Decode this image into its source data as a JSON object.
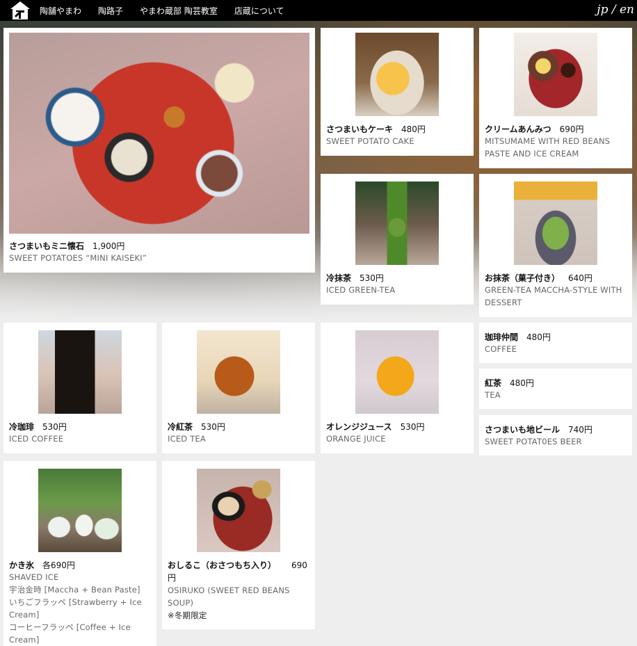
{
  "header": {
    "nav": [
      "陶舗やまわ",
      "陶路子",
      "やまわ蔵部 陶芸教室",
      "店蔵について"
    ],
    "lang": "jp / en"
  },
  "items": [
    {
      "name": "さつまいもミニ懐石",
      "price": "1,900円",
      "en": "SWEET POTATOES “MINI KAISEKI”"
    },
    {
      "name": "さつまいもケーキ",
      "price": "480円",
      "en": "SWEET POTATO CAKE"
    },
    {
      "name": "クリームあんみつ",
      "price": "690円",
      "en": "MITSUMAME WITH RED BEANS PASTE AND ICE CREAM"
    },
    {
      "name": "冷抹茶",
      "price": "530円",
      "en": "ICED GREEN-TEA"
    },
    {
      "name": "お抹茶（菓子付き）",
      "price": "640円",
      "en": "GREEN-TEA MACCHA-STYLE WITH DESSERT"
    },
    {
      "name": "冷珈琲",
      "price": "530円",
      "en": "ICED COFFEE"
    },
    {
      "name": "冷紅茶",
      "price": "530円",
      "en": "ICED TEA"
    },
    {
      "name": "オレンジジュース",
      "price": "530円",
      "en": "ORANGE JUICE"
    },
    {
      "name": "珈琲仲間",
      "price": "480円",
      "en": "COFFEE"
    },
    {
      "name": "紅茶",
      "price": "480円",
      "en": "TEA"
    },
    {
      "name": "さつまいも地ビール",
      "price": "740円",
      "en": "SWEET POTAT0ES BEER"
    },
    {
      "name": "かき氷",
      "price": "各690円",
      "en": "SHAVED ICE",
      "extra": [
        "宇治金時 [Maccha + Bean Paste]",
        "いちごフラッペ [Strawberry + Ice Cream]",
        "コーヒーフラッペ [Coffee + Ice Cream]"
      ]
    },
    {
      "name": "おしるこ（おさつもち入り）",
      "price": "690円",
      "en": "OSIRUKO (SWEET RED BEANS SOUP)",
      "note": "※冬期限定"
    }
  ]
}
